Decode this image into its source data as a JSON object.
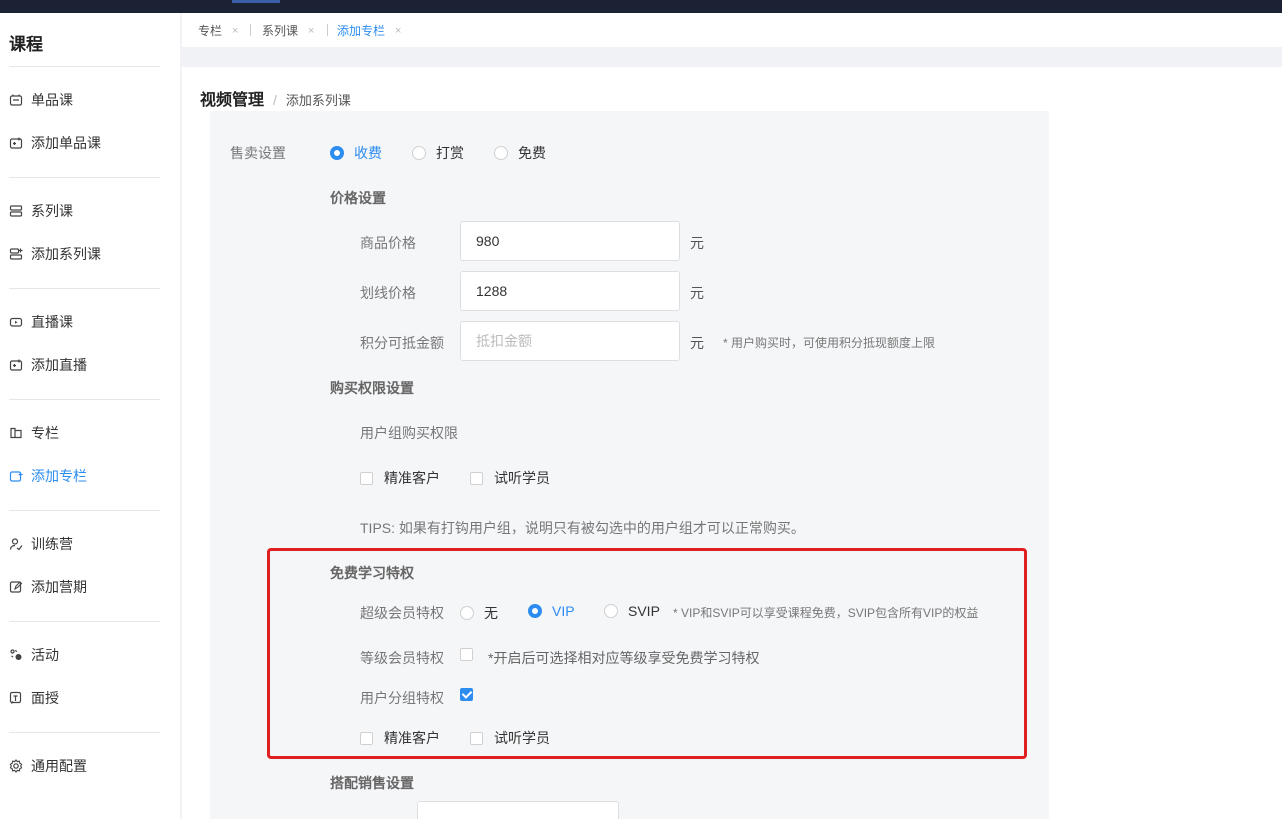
{
  "sidebar": {
    "title": "课程",
    "items": [
      {
        "label": "单品课",
        "icon": "course-icon"
      },
      {
        "label": "添加单品课",
        "icon": "add-course-icon"
      },
      {
        "label": "系列课",
        "icon": "series-icon"
      },
      {
        "label": "添加系列课",
        "icon": "add-series-icon"
      },
      {
        "label": "直播课",
        "icon": "live-icon"
      },
      {
        "label": "添加直播",
        "icon": "add-live-icon"
      },
      {
        "label": "专栏",
        "icon": "column-icon"
      },
      {
        "label": "添加专栏",
        "icon": "add-column-icon"
      },
      {
        "label": "训练营",
        "icon": "camp-icon"
      },
      {
        "label": "添加营期",
        "icon": "add-camp-icon"
      },
      {
        "label": "活动",
        "icon": "activity-icon"
      },
      {
        "label": "面授",
        "icon": "offline-icon"
      },
      {
        "label": "通用配置",
        "icon": "gear-icon"
      }
    ]
  },
  "tabs": [
    {
      "label": "专栏",
      "close": "×"
    },
    {
      "label": "系列课",
      "close": "×"
    },
    {
      "label": "添加专栏",
      "close": "×"
    }
  ],
  "breadcrumb": {
    "main": "视频管理",
    "sep": "/",
    "sub": "添加系列课"
  },
  "sale": {
    "label": "售卖设置",
    "options": [
      "收费",
      "打赏",
      "免费"
    ],
    "selected": "收费"
  },
  "price": {
    "section": "价格设置",
    "goods_label": "商品价格",
    "goods_value": "980",
    "strike_label": "划线价格",
    "strike_value": "1288",
    "points_label": "积分可抵金额",
    "points_placeholder": "抵扣金额",
    "unit": "元",
    "points_hint": "* 用户购买时，可使用积分抵现额度上限"
  },
  "purchase": {
    "section": "购买权限设置",
    "group_label": "用户组购买权限",
    "groups": [
      "精准客户",
      "试听学员"
    ],
    "tips": "TIPS: 如果有打钩用户组，说明只有被勾选中的用户组才可以正常购买。"
  },
  "free": {
    "section": "免费学习特权",
    "super_label": "超级会员特权",
    "super_options": [
      "无",
      "VIP",
      "SVIP"
    ],
    "super_selected": "VIP",
    "super_hint": "* VIP和SVIP可以享受课程免费，SVIP包含所有VIP的权益",
    "level_label": "等级会员特权",
    "level_hint": "*开启后可选择相对应等级享受免费学习特权",
    "group_label": "用户分组特权",
    "groups": [
      "精准客户",
      "试听学员"
    ]
  },
  "bundle": {
    "section": "搭配销售设置"
  },
  "colors": {
    "accent": "#2d8cf0",
    "highlight": "#e02020",
    "topbar": "#1a2233"
  }
}
